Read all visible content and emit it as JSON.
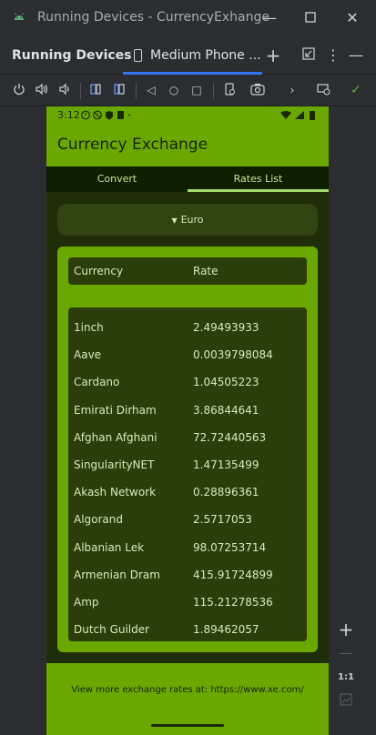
{
  "window": {
    "title": "Running Devices - CurrencyExhange"
  },
  "tool": {
    "name": "Running Devices",
    "tab_label": "Medium Phone ..."
  },
  "device": {
    "status_time": "3:12",
    "app_title": "Currency Exchange",
    "tabs": [
      "Convert",
      "Rates List"
    ],
    "selected_tab": "Rates List",
    "currency_selected": "Euro",
    "table_headers": [
      "Currency",
      "Rate"
    ],
    "rates": [
      {
        "currency": "1inch",
        "rate": "2.49493933"
      },
      {
        "currency": "Aave",
        "rate": "0.0039798084"
      },
      {
        "currency": "Cardano",
        "rate": "1.04505223"
      },
      {
        "currency": "Emirati Dirham",
        "rate": "3.86844641"
      },
      {
        "currency": "Afghan Afghani",
        "rate": "72.72440563"
      },
      {
        "currency": "SingularityNET",
        "rate": "1.47135499"
      },
      {
        "currency": "Akash Network",
        "rate": "0.28896361"
      },
      {
        "currency": "Algorand",
        "rate": "2.5717053"
      },
      {
        "currency": "Albanian Lek",
        "rate": "98.07253714"
      },
      {
        "currency": "Armenian Dram",
        "rate": "415.91724899"
      },
      {
        "currency": "Amp",
        "rate": "115.21278536"
      },
      {
        "currency": "Dutch Guilder",
        "rate": "1.89462057"
      }
    ],
    "footer_text": "View more exchange rates at: https://www.xe.com/"
  },
  "zoom": {
    "one_to_one": "1:1"
  },
  "colors": {
    "app_primary": "#6aa800",
    "app_dark": "#1f2e08",
    "ide_bg": "#2b2d30",
    "accent": "#3574f0"
  }
}
